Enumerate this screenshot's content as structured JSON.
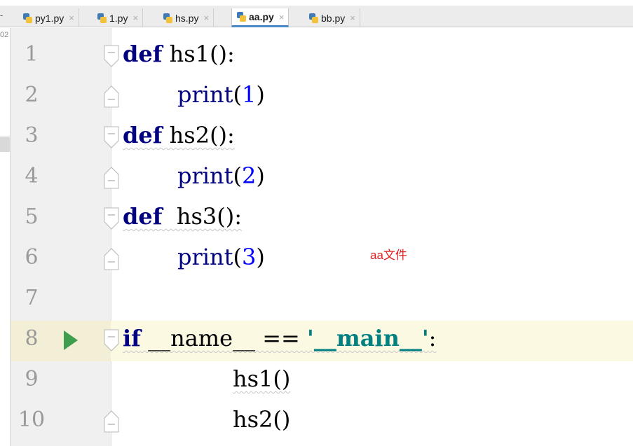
{
  "tabs": [
    {
      "label": "py1.py",
      "close": "×",
      "active": false
    },
    {
      "label": "1.py",
      "close": "×",
      "active": false
    },
    {
      "label": "hs.py",
      "close": "×",
      "active": false
    },
    {
      "label": "aa.py",
      "close": "×",
      "active": true
    },
    {
      "label": "bb.py",
      "close": "×",
      "active": false
    }
  ],
  "tabbar_lead": "-",
  "left_panel_fragment": "02",
  "lines": [
    {
      "num": "1",
      "kw": "def",
      "rest": " hs1():"
    },
    {
      "num": "2",
      "fn": "print",
      "open": "(",
      "arg": "1",
      "close": ")"
    },
    {
      "num": "3",
      "kw": "def",
      "rest": " hs2():"
    },
    {
      "num": "4",
      "fn": "print",
      "open": "(",
      "arg": "2",
      "close": ")"
    },
    {
      "num": "5",
      "kw": "def",
      "rest": "  hs3():"
    },
    {
      "num": "6",
      "fn": "print",
      "open": "(",
      "arg": "3",
      "close": ")"
    },
    {
      "num": "7"
    },
    {
      "num": "8",
      "kw": "if",
      "mid": " __name__ == ",
      "str": "'__main__'",
      "end": ":"
    },
    {
      "num": "9",
      "call": "hs1()"
    },
    {
      "num": "10",
      "call": "hs2()"
    }
  ],
  "annotation": "aa文件",
  "colors": {
    "keyword": "#000080",
    "number": "#0000ff",
    "string": "#008080",
    "run_icon": "#3f9e4d",
    "annotation": "#e02020",
    "current_line": "#fcf9e3"
  }
}
